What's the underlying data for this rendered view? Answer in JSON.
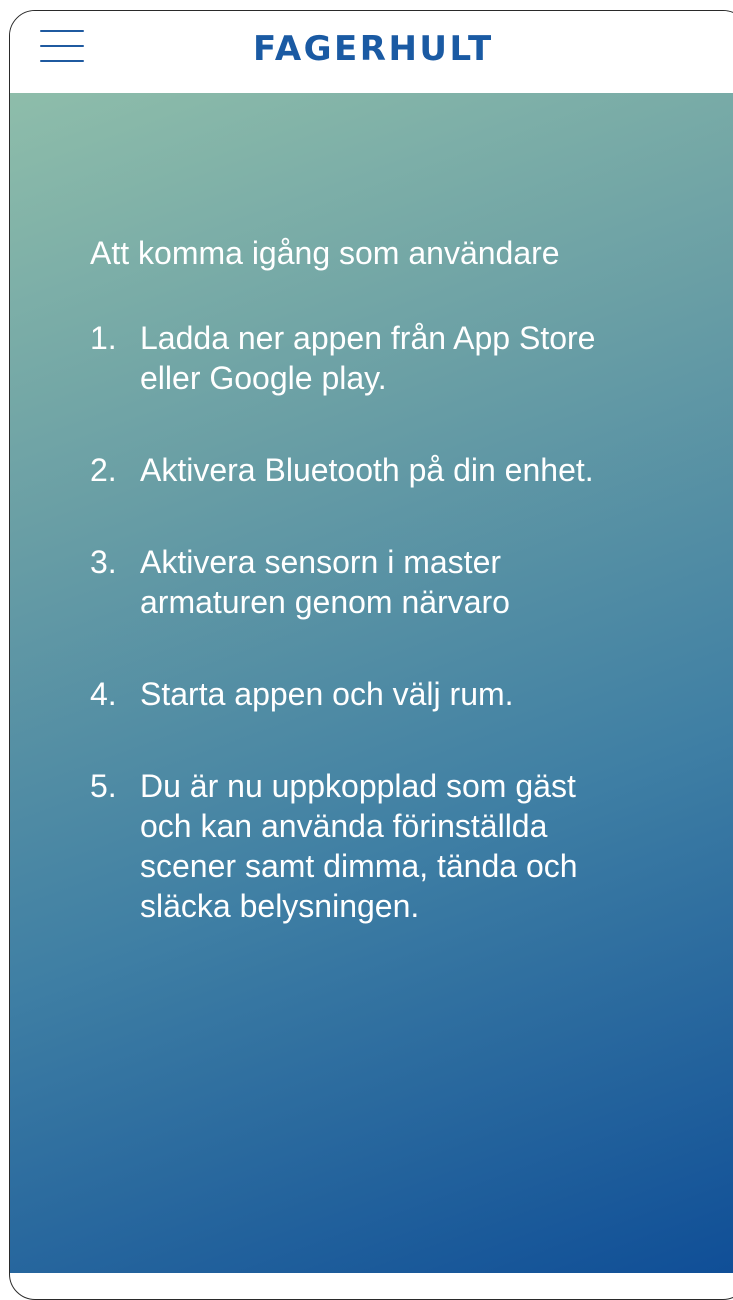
{
  "header": {
    "logo_text": "FAGERHULT",
    "menu_icon": "hamburger-menu-icon",
    "accent_color": "#1a5aa3"
  },
  "main": {
    "heading": "Att komma igång som användare",
    "steps": [
      {
        "number": "1.",
        "text": "Ladda ner appen från App Store\neller Google play."
      },
      {
        "number": "2.",
        "text": "Aktivera Bluetooth på din enhet."
      },
      {
        "number": "3.",
        "text": "Aktivera sensorn i master\narmaturen genom närvaro"
      },
      {
        "number": "4.",
        "text": "Starta appen och välj rum."
      },
      {
        "number": "5.",
        "text": "Du är nu uppkopplad som gäst\noch kan använda förinställda\nscener samt  dimma, tända och\nsläcka belysningen."
      }
    ],
    "gradient_colors": [
      "#8ebdaa",
      "#6a9fa5",
      "#3f7fa4",
      "#0f4e97"
    ]
  }
}
